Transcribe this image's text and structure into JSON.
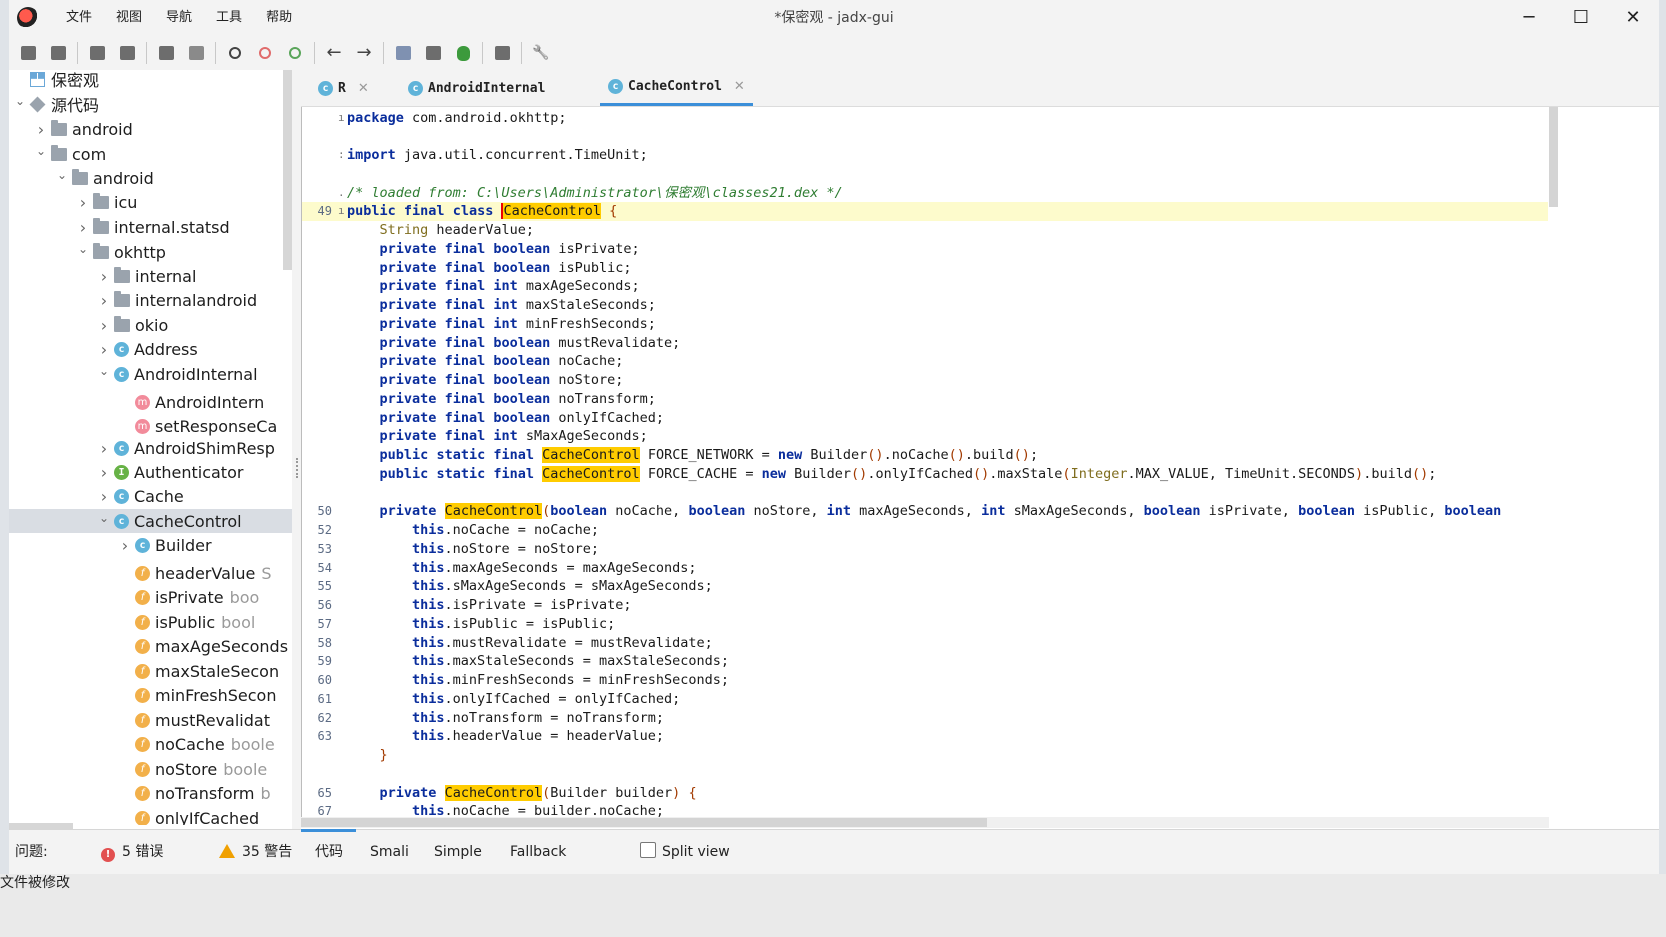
{
  "window": {
    "title": "*保密观 - jadx-gui",
    "min": "─",
    "max": "☐",
    "close": "✕"
  },
  "menu": [
    "文件",
    "视图",
    "导航",
    "工具",
    "帮助"
  ],
  "toolbar_icons": [
    "open-file-icon",
    "add-files-icon",
    "save-all-icon",
    "export-icon",
    "sync-tree-icon",
    "flatten-packages-icon",
    "search-icon",
    "find-class-icon",
    "find-usage-icon",
    "back-icon",
    "forward-icon",
    "deobfuscation-icon",
    "log-viewer-icon",
    "debugger-icon",
    "decompile-all-icon",
    "preferences-icon"
  ],
  "tree": [
    {
      "indent": 0,
      "chev": "",
      "icon": "proj",
      "label": "保密观",
      "extra": ""
    },
    {
      "indent": 0,
      "chev": "v",
      "icon": "src",
      "label": "源代码",
      "extra": ""
    },
    {
      "indent": 1,
      "chev": ">",
      "icon": "folder",
      "label": "android",
      "extra": ""
    },
    {
      "indent": 1,
      "chev": "v",
      "icon": "folder",
      "label": "com",
      "extra": ""
    },
    {
      "indent": 2,
      "chev": "v",
      "icon": "folder",
      "label": "android",
      "extra": ""
    },
    {
      "indent": 3,
      "chev": ">",
      "icon": "folder",
      "label": "icu",
      "extra": ""
    },
    {
      "indent": 3,
      "chev": ">",
      "icon": "folder",
      "label": "internal.statsd",
      "extra": ""
    },
    {
      "indent": 3,
      "chev": "v",
      "icon": "folder",
      "label": "okhttp",
      "extra": ""
    },
    {
      "indent": 4,
      "chev": ">",
      "icon": "folder",
      "label": "internal",
      "extra": ""
    },
    {
      "indent": 4,
      "chev": ">",
      "icon": "folder",
      "label": "internalandroid",
      "extra": ""
    },
    {
      "indent": 4,
      "chev": ">",
      "icon": "folder",
      "label": "okio",
      "extra": ""
    },
    {
      "indent": 4,
      "chev": ">",
      "icon": "c",
      "label": "Address",
      "extra": ""
    },
    {
      "indent": 4,
      "chev": "v",
      "icon": "c",
      "label": "AndroidInternal",
      "extra": ""
    },
    {
      "indent": 5,
      "chev": "",
      "icon": "m",
      "label": "AndroidIntern",
      "extra": ""
    },
    {
      "indent": 5,
      "chev": "",
      "icon": "m",
      "label": "setResponseCa",
      "extra": ""
    },
    {
      "indent": 4,
      "chev": ">",
      "icon": "c",
      "label": "AndroidShimResp",
      "extra": ""
    },
    {
      "indent": 4,
      "chev": ">",
      "icon": "i",
      "label": "Authenticator",
      "extra": ""
    },
    {
      "indent": 4,
      "chev": ">",
      "icon": "c",
      "label": "Cache",
      "extra": ""
    },
    {
      "indent": 4,
      "chev": "v",
      "icon": "c",
      "label": "CacheControl",
      "extra": "",
      "sel": true
    },
    {
      "indent": 5,
      "chev": ">",
      "icon": "c",
      "label": "Builder",
      "extra": ""
    },
    {
      "indent": 5,
      "chev": "",
      "icon": "f",
      "label": "headerValue",
      "extra": "S"
    },
    {
      "indent": 5,
      "chev": "",
      "icon": "f",
      "label": "isPrivate",
      "extra": "boo"
    },
    {
      "indent": 5,
      "chev": "",
      "icon": "f",
      "label": "isPublic",
      "extra": "bool"
    },
    {
      "indent": 5,
      "chev": "",
      "icon": "f",
      "label": "maxAgeSeconds",
      "extra": ""
    },
    {
      "indent": 5,
      "chev": "",
      "icon": "f",
      "label": "maxStaleSecon",
      "extra": ""
    },
    {
      "indent": 5,
      "chev": "",
      "icon": "f",
      "label": "minFreshSecon",
      "extra": ""
    },
    {
      "indent": 5,
      "chev": "",
      "icon": "f",
      "label": "mustRevalidat",
      "extra": ""
    },
    {
      "indent": 5,
      "chev": "",
      "icon": "f",
      "label": "noCache",
      "extra": "boole"
    },
    {
      "indent": 5,
      "chev": "",
      "icon": "f",
      "label": "noStore",
      "extra": "boole"
    },
    {
      "indent": 5,
      "chev": "",
      "icon": "f",
      "label": "noTransform",
      "extra": "b"
    },
    {
      "indent": 5,
      "chev": "",
      "icon": "f",
      "label": "onlyIfCached",
      "extra": ""
    }
  ],
  "tabs": [
    {
      "label": "R",
      "close": "✕",
      "active": false
    },
    {
      "label": "AndroidInternal",
      "close": "",
      "active": false
    },
    {
      "label": "CacheControl",
      "close": "✕",
      "active": true
    }
  ],
  "code_lines": [
    {
      "ln": "",
      "g": "ı",
      "t": "package com.android.okhttp;"
    },
    {
      "ln": "",
      "g": "",
      "t": ""
    },
    {
      "ln": "",
      "g": ":",
      "t": "import java.util.concurrent.TimeUnit;"
    },
    {
      "ln": "",
      "g": "",
      "t": ""
    },
    {
      "ln": "",
      "g": ".",
      "t": "/* loaded from: C:\\Users\\Administrator\\保密观\\classes21.dex */"
    },
    {
      "ln": "49",
      "g": "ı",
      "t": "public final class CacheControl {",
      "cur": true
    },
    {
      "ln": "",
      "g": "",
      "t": "    String headerValue;"
    },
    {
      "ln": "",
      "g": "",
      "t": "    private final boolean isPrivate;"
    },
    {
      "ln": "",
      "g": "",
      "t": "    private final boolean isPublic;"
    },
    {
      "ln": "",
      "g": "",
      "t": "    private final int maxAgeSeconds;"
    },
    {
      "ln": "",
      "g": "",
      "t": "    private final int maxStaleSeconds;"
    },
    {
      "ln": "",
      "g": "",
      "t": "    private final int minFreshSeconds;"
    },
    {
      "ln": "",
      "g": "",
      "t": "    private final boolean mustRevalidate;"
    },
    {
      "ln": "",
      "g": "",
      "t": "    private final boolean noCache;"
    },
    {
      "ln": "",
      "g": "",
      "t": "    private final boolean noStore;"
    },
    {
      "ln": "",
      "g": "",
      "t": "    private final boolean noTransform;"
    },
    {
      "ln": "",
      "g": "",
      "t": "    private final boolean onlyIfCached;"
    },
    {
      "ln": "",
      "g": "",
      "t": "    private final int sMaxAgeSeconds;"
    },
    {
      "ln": "",
      "g": "",
      "t": "    public static final CacheControl FORCE_NETWORK = new Builder().noCache().build();"
    },
    {
      "ln": "",
      "g": "",
      "t": "    public static final CacheControl FORCE_CACHE = new Builder().onlyIfCached().maxStale(Integer.MAX_VALUE, TimeUnit.SECONDS).build();"
    },
    {
      "ln": "",
      "g": "",
      "t": ""
    },
    {
      "ln": "50",
      "g": "",
      "t": "    private CacheControl(boolean noCache, boolean noStore, int maxAgeSeconds, int sMaxAgeSeconds, boolean isPrivate, boolean isPublic, boolean"
    },
    {
      "ln": "52",
      "g": "",
      "t": "        this.noCache = noCache;"
    },
    {
      "ln": "53",
      "g": "",
      "t": "        this.noStore = noStore;"
    },
    {
      "ln": "54",
      "g": "",
      "t": "        this.maxAgeSeconds = maxAgeSeconds;"
    },
    {
      "ln": "55",
      "g": "",
      "t": "        this.sMaxAgeSeconds = sMaxAgeSeconds;"
    },
    {
      "ln": "56",
      "g": "",
      "t": "        this.isPrivate = isPrivate;"
    },
    {
      "ln": "57",
      "g": "",
      "t": "        this.isPublic = isPublic;"
    },
    {
      "ln": "58",
      "g": "",
      "t": "        this.mustRevalidate = mustRevalidate;"
    },
    {
      "ln": "59",
      "g": "",
      "t": "        this.maxStaleSeconds = maxStaleSeconds;"
    },
    {
      "ln": "60",
      "g": "",
      "t": "        this.minFreshSeconds = minFreshSeconds;"
    },
    {
      "ln": "61",
      "g": "",
      "t": "        this.onlyIfCached = onlyIfCached;"
    },
    {
      "ln": "62",
      "g": "",
      "t": "        this.noTransform = noTransform;"
    },
    {
      "ln": "63",
      "g": "",
      "t": "        this.headerValue = headerValue;"
    },
    {
      "ln": "",
      "g": "",
      "t": "    }"
    },
    {
      "ln": "",
      "g": "",
      "t": ""
    },
    {
      "ln": "65",
      "g": "",
      "t": "    private CacheControl(Builder builder) {"
    },
    {
      "ln": "67",
      "g": "",
      "t": "        this.noCache = builder.noCache;"
    }
  ],
  "highlight_word": "CacheControl",
  "bottom": {
    "problems_label": "问题:",
    "errors": "5 错误",
    "warnings": "35 警告",
    "views": [
      "代码",
      "Smali",
      "Simple",
      "Fallback"
    ],
    "split_view": "Split view"
  },
  "status": "文件被修改"
}
